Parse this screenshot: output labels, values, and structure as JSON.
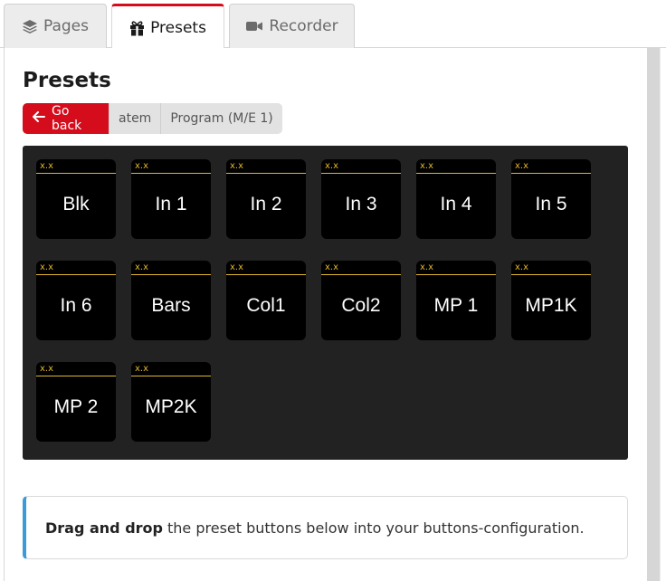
{
  "tabs": [
    {
      "label": "Pages",
      "icon": "layers-icon"
    },
    {
      "label": "Presets",
      "icon": "gift-icon"
    },
    {
      "label": "Recorder",
      "icon": "video-camera-icon"
    }
  ],
  "active_tab": "Presets",
  "page": {
    "title": "Presets"
  },
  "breadcrumb": {
    "back_label": "Go back",
    "items": [
      "atem",
      "Program (M/E 1)"
    ]
  },
  "colors": {
    "accent": "#d50c1c",
    "info": "#3b9ad9",
    "preset_tag": "#e2b62c",
    "panel": "#222222"
  },
  "presets": [
    {
      "tag": "x.x",
      "label": "Blk"
    },
    {
      "tag": "x.x",
      "label": "In 1"
    },
    {
      "tag": "x.x",
      "label": "In 2"
    },
    {
      "tag": "x.x",
      "label": "In 3"
    },
    {
      "tag": "x.x",
      "label": "In 4"
    },
    {
      "tag": "x.x",
      "label": "In 5"
    },
    {
      "tag": "x.x",
      "label": "In 6"
    },
    {
      "tag": "x.x",
      "label": "Bars"
    },
    {
      "tag": "x.x",
      "label": "Col1"
    },
    {
      "tag": "x.x",
      "label": "Col2"
    },
    {
      "tag": "x.x",
      "label": "MP 1"
    },
    {
      "tag": "x.x",
      "label": "MP1K"
    },
    {
      "tag": "x.x",
      "label": "MP 2"
    },
    {
      "tag": "x.x",
      "label": "MP2K"
    }
  ],
  "callout": {
    "bold": "Drag and drop",
    "text": "the preset buttons below into your buttons-configuration."
  }
}
